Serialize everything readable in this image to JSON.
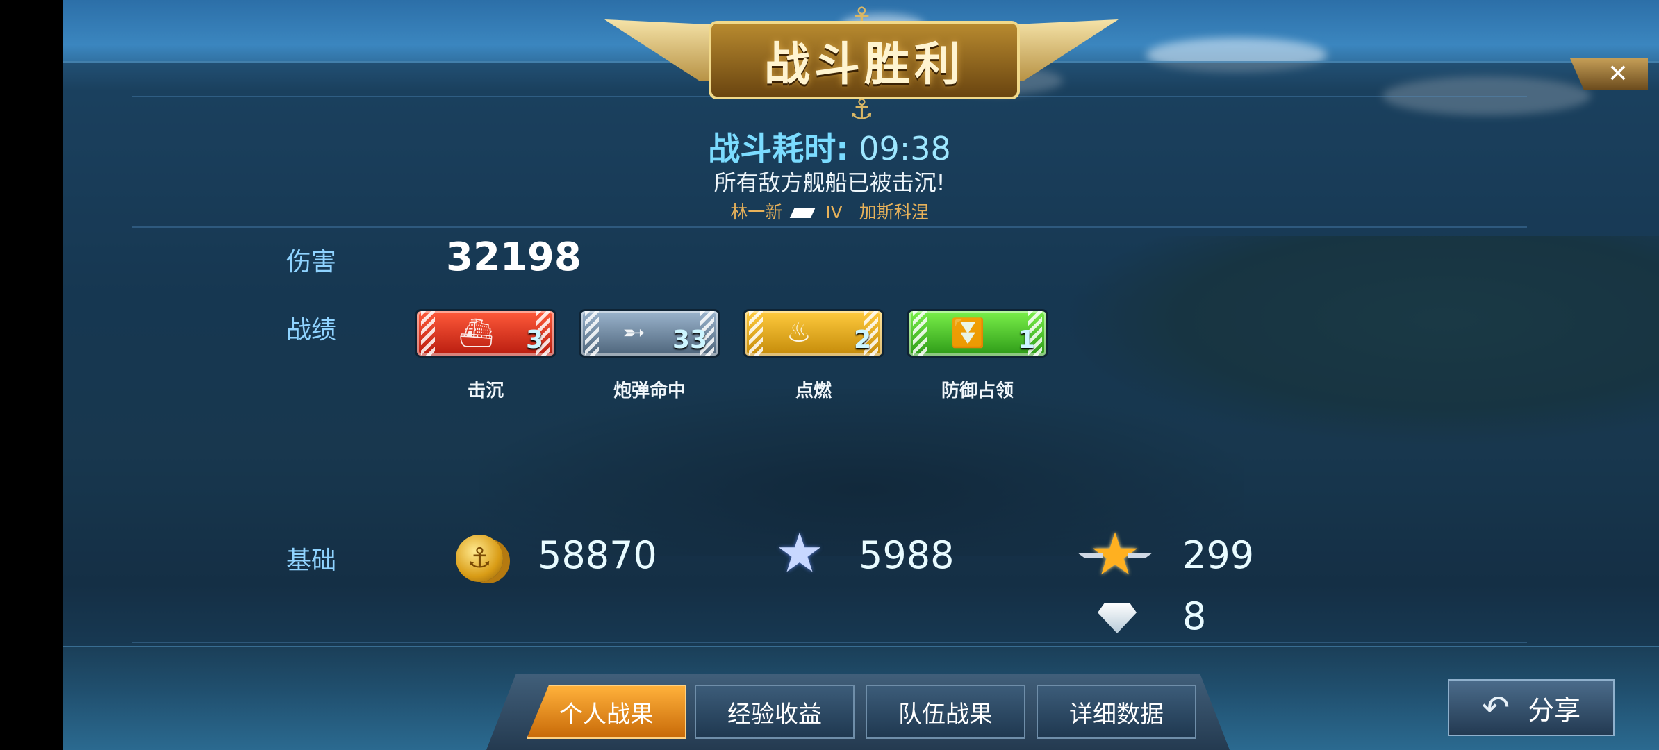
{
  "banner": {
    "title": "战斗胜利"
  },
  "close": {
    "label": "✕"
  },
  "battle": {
    "duration_label": "战斗耗时:",
    "duration_value": "09:38",
    "result_text": "所有敌方舰船已被击沉!",
    "player_name": "林一新",
    "ship_tier": "IV",
    "ship_name": "加斯科涅"
  },
  "stats": {
    "damage_label": "伤害",
    "damage_value": "32198",
    "record_label": "战绩",
    "medals": [
      {
        "icon": "sinking-ship-icon",
        "count": "3",
        "label": "击沉",
        "color": "#e2321d"
      },
      {
        "icon": "shell-hit-icon",
        "count": "33",
        "label": "炮弹命中",
        "color": "#6b8299"
      },
      {
        "icon": "fire-icon",
        "count": "2",
        "label": "点燃",
        "color": "#e2a81a"
      },
      {
        "icon": "defense-capture-icon",
        "count": "1",
        "label": "防御占领",
        "color": "#47c62a"
      }
    ]
  },
  "rewards": {
    "base_label": "基础",
    "coins": "58870",
    "exp": "5988",
    "captain_exp": "299",
    "diamonds": "8"
  },
  "tabs": {
    "personal": "个人战果",
    "exp": "经验收益",
    "team": "队伍战果",
    "details": "详细数据"
  },
  "share": {
    "label": "分享"
  }
}
